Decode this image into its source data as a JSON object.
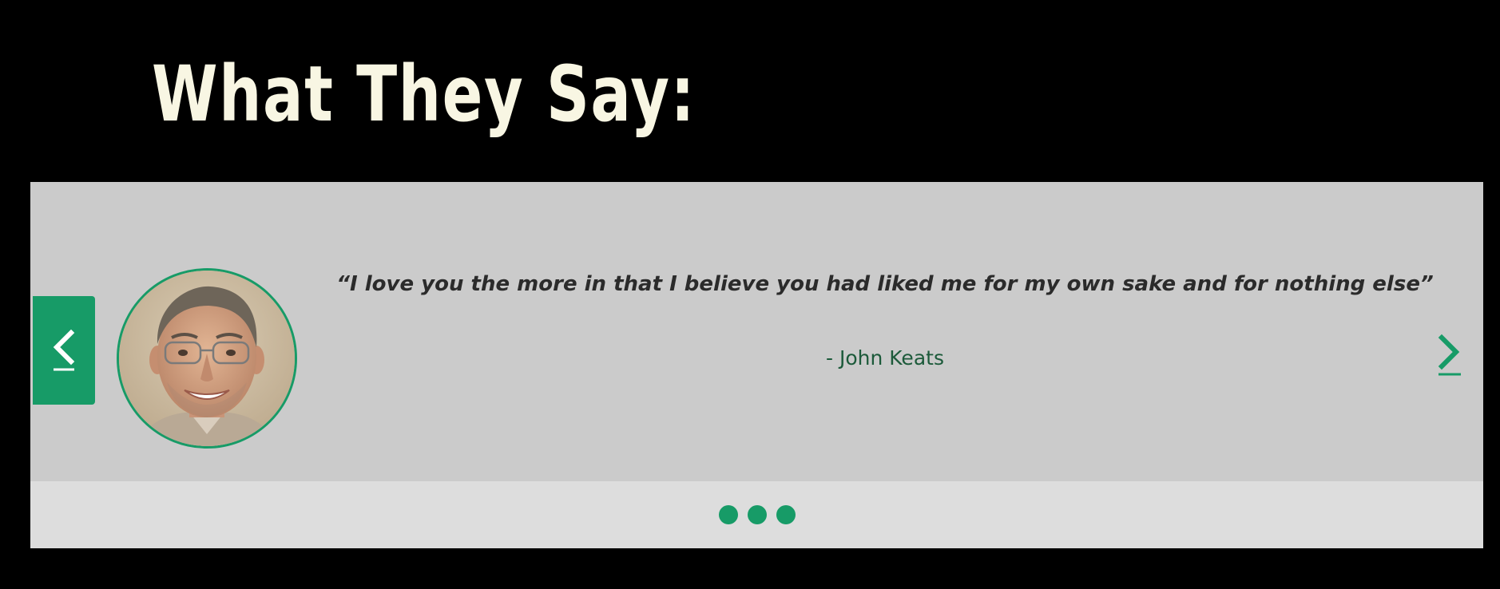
{
  "section": {
    "heading": "What They Say:"
  },
  "testimonial": {
    "quote": "“I love you the more in that I believe you had liked me for my own sake and for nothing else”",
    "author": "- John Keats"
  },
  "controls": {
    "prev_icon": "chevron-left-icon",
    "next_icon": "chevron-right-icon",
    "dot_count": 3,
    "active_dot": 1
  },
  "colors": {
    "accent": "#179b67",
    "background": "#000000",
    "heading": "#f8f6e3",
    "slide_bg": "#cbcbcb",
    "dots_bar_bg": "#dddddd",
    "author_text": "#1c5a3a"
  }
}
